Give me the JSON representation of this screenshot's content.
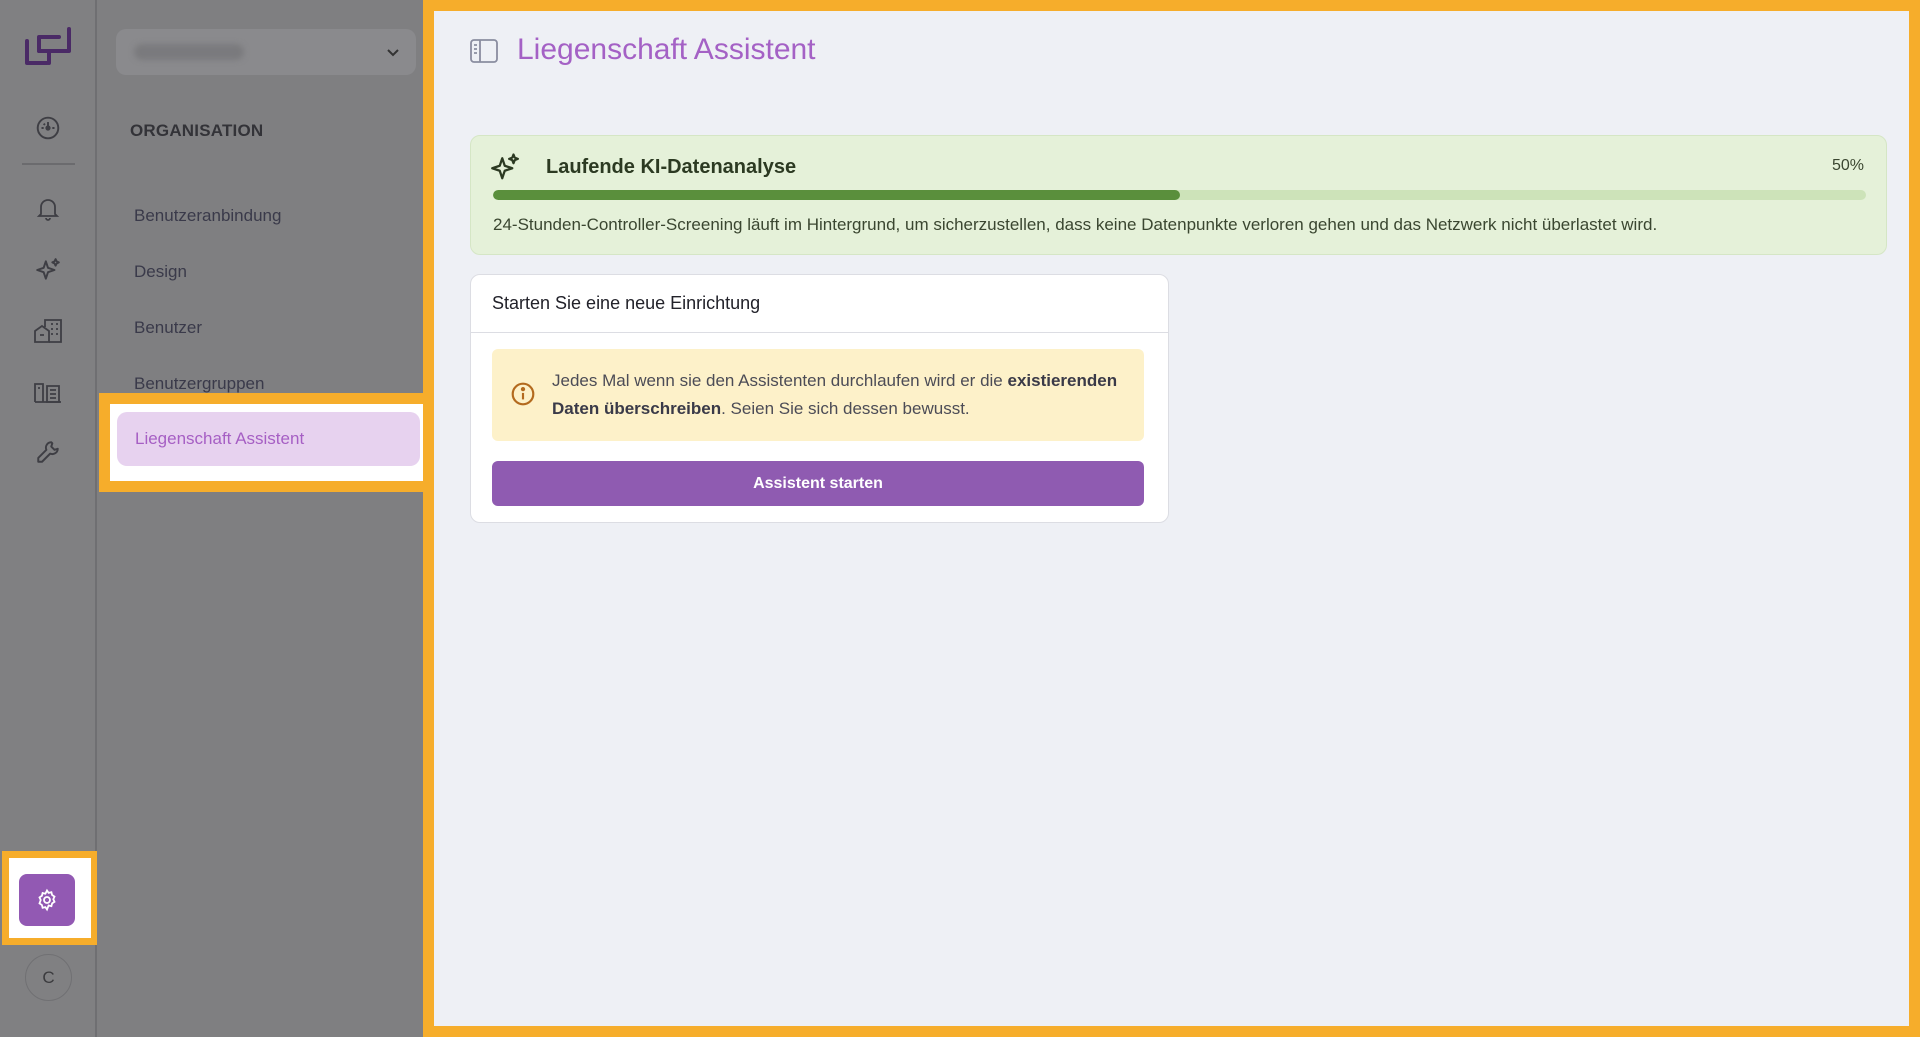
{
  "colors": {
    "accent": "#a461c5",
    "highlight": "#f6ad2b",
    "button": "#8f5bb1",
    "success": "#5a8f3c"
  },
  "rail": {
    "logo": "app-logo-icon",
    "items": [
      {
        "name": "dashboard-icon"
      },
      {
        "name": "bell-icon"
      },
      {
        "name": "sparkles-icon"
      },
      {
        "name": "buildings-icon"
      },
      {
        "name": "property-list-icon"
      },
      {
        "name": "wrench-icon"
      }
    ],
    "settings_icon": "gear-icon",
    "avatar_initial": "C"
  },
  "subnav": {
    "section": "ORGANISATION",
    "items": [
      {
        "label": "Benutzeranbindung"
      },
      {
        "label": "Design"
      },
      {
        "label": "Benutzer"
      },
      {
        "label": "Benutzergruppen"
      }
    ],
    "active_item": "Liegenschaft Assistent"
  },
  "main": {
    "title": "Liegenschaft Assistent",
    "ai_card": {
      "title": "Laufende KI-Datenanalyse",
      "progress": 0.5,
      "progress_label": "50%",
      "description": "24-Stunden-Controller-Screening läuft im Hintergrund, um sicherzustellen, dass keine Datenpunkte verloren gehen und das Netzwerk nicht überlastet wird."
    },
    "setup_card": {
      "title": "Starten Sie eine neue Einrichtung",
      "warning_pre": "Jedes Mal wenn sie den Assistenten durchlaufen wird er die ",
      "warning_bold": "existierenden Daten überschreiben",
      "warning_post": ". Seien Sie sich dessen bewusst.",
      "button_label": "Assistent starten"
    }
  }
}
